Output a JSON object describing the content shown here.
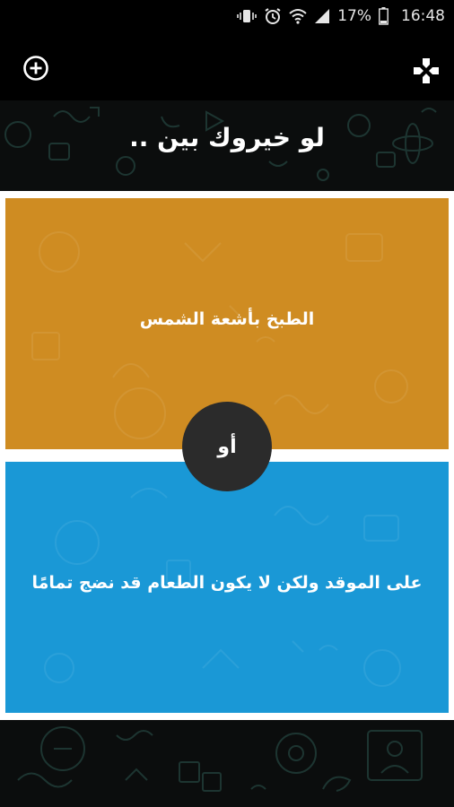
{
  "status_bar": {
    "battery_percent": "17%",
    "time": "16:48",
    "icons": [
      "vibrate-icon",
      "alarm-icon",
      "wifi-icon",
      "signal-icon",
      "battery-icon"
    ]
  },
  "app_bar": {
    "left_icon": "add-circle-icon",
    "right_icon": "gamepad-icon"
  },
  "heading": "لو خيروك بين ..",
  "options": [
    {
      "text": "الطبخ بأشعة الشمس",
      "color": "#cf8c22"
    },
    {
      "text": "على الموقد ولكن لا يكون الطعام قد نضج تمامًا",
      "color": "#1a98d6"
    }
  ],
  "or_label": "أو",
  "colors": {
    "background": "#0b0d0d",
    "bar": "#000000",
    "badge": "#2b2b2b"
  }
}
